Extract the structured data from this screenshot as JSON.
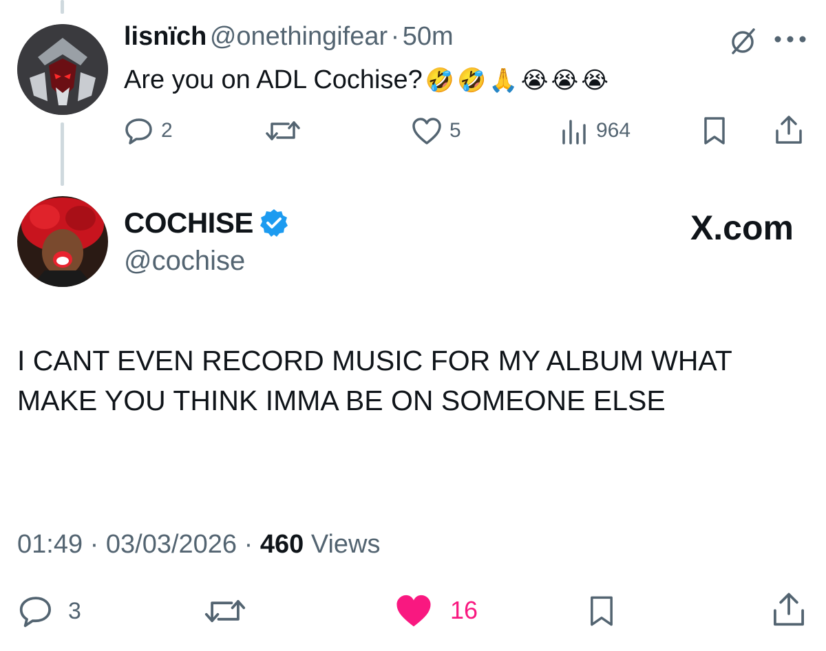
{
  "reply": {
    "display_name": "lisnïch",
    "handle": "@onethingifear",
    "separator": "·",
    "time": "50m",
    "text": "Are you on ADL Cochise?",
    "emojis": [
      "🤣",
      "🤣",
      "🙏",
      "😭",
      "😭",
      "😭"
    ],
    "actions": {
      "replies": "2",
      "reposts": "",
      "likes": "5",
      "views": "964"
    }
  },
  "main": {
    "display_name": "COCHISE",
    "verified": true,
    "handle": "@cochise",
    "brand": "X.com",
    "text": "I CANT EVEN RECORD MUSIC FOR MY ALBUM WHAT MAKE YOU THINK IMMA BE ON SOMEONE ELSE",
    "meta": {
      "time": "01:49",
      "date": "03/03/2026",
      "views_count": "460",
      "views_label": "Views",
      "separator": "·"
    },
    "actions": {
      "replies": "3",
      "reposts": "",
      "likes": "16",
      "liked": true
    }
  },
  "colors": {
    "text": "#0f1419",
    "muted": "#536471",
    "verified": "#1d9bf0",
    "like_active": "#f91880",
    "thread_line": "#cfd9de"
  },
  "icons": {
    "grok": "grok-slash-icon",
    "more": "more-dots-icon",
    "reply": "reply-bubble-icon",
    "repost": "repost-arrows-icon",
    "like": "heart-icon",
    "views": "views-bars-icon",
    "bookmark": "bookmark-icon",
    "share": "share-upload-icon",
    "verified": "verified-badge-icon"
  }
}
